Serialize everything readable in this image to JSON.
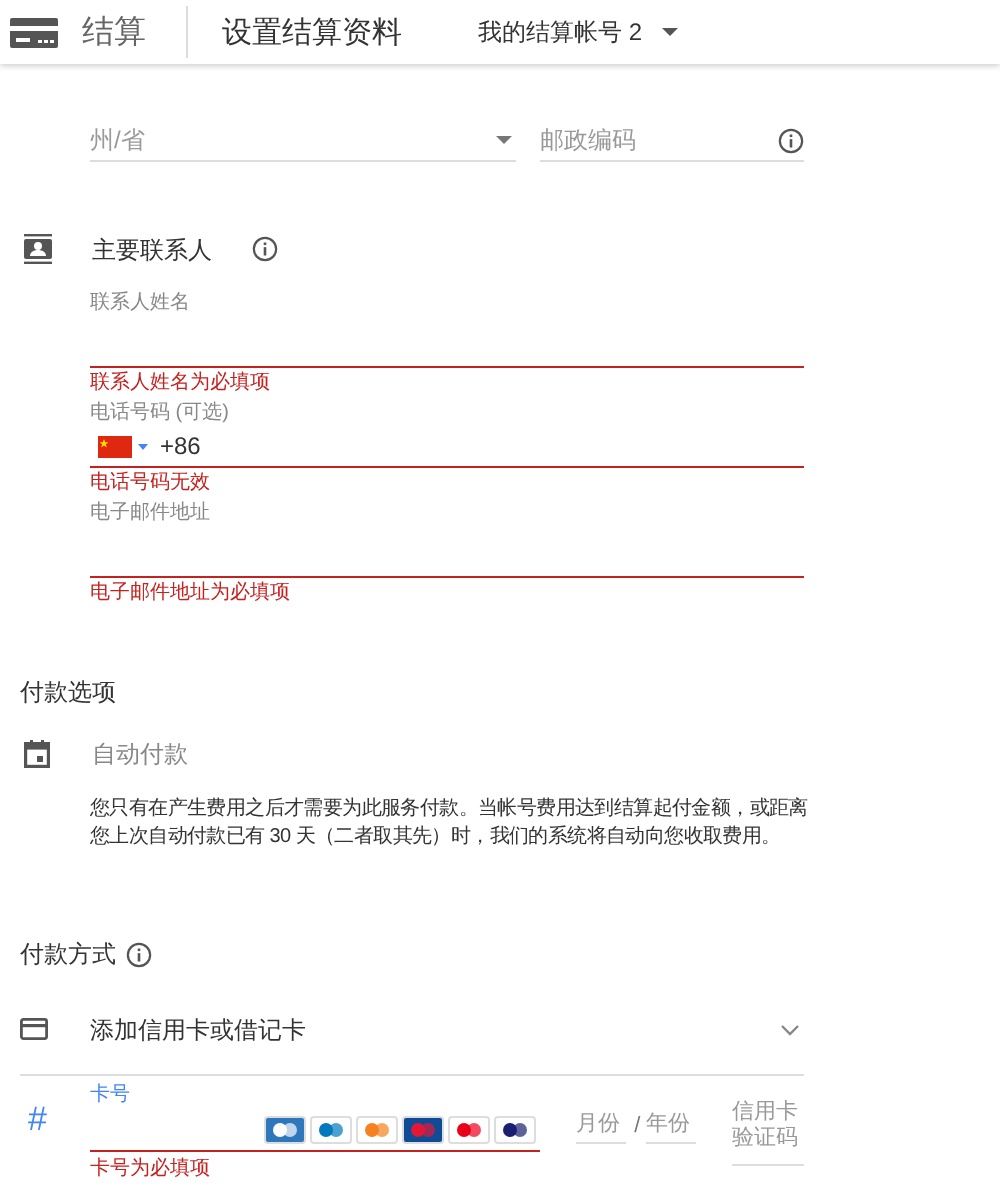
{
  "header": {
    "product": "结算",
    "title": "设置结算资料",
    "account": "我的结算帐号 2"
  },
  "address": {
    "state": {
      "placeholder": "州/省"
    },
    "postal": {
      "placeholder": "邮政编码"
    }
  },
  "contact": {
    "title": "主要联系人",
    "fields": [
      {
        "label": "联系人姓名",
        "kind": "text",
        "error": "联系人姓名为必填项"
      },
      {
        "label": "电话号码 (可选)",
        "kind": "phone",
        "value": "+86",
        "error": "电话号码无效"
      },
      {
        "label": "电子邮件地址",
        "kind": "text",
        "error": "电子邮件地址为必填项"
      }
    ]
  },
  "payment_options": {
    "title": "付款选项",
    "type": "自动付款",
    "description": "您只有在产生费用之后才需要为此服务付款。当帐号费用达到结算起付金额，或距离您上次自动付款已有 30 天（二者取其先）时，我们的系统将自动向您收取费用。"
  },
  "payment_method": {
    "title": "付款方式",
    "method": "添加信用卡或借记卡",
    "card_icon": "#",
    "card_number": {
      "label": "卡号",
      "error": "卡号为必填项"
    },
    "month": {
      "placeholder": "月份"
    },
    "separator": "/",
    "year": {
      "placeholder": "年份"
    },
    "cvc": {
      "placeholder": "信用卡验证码"
    }
  }
}
